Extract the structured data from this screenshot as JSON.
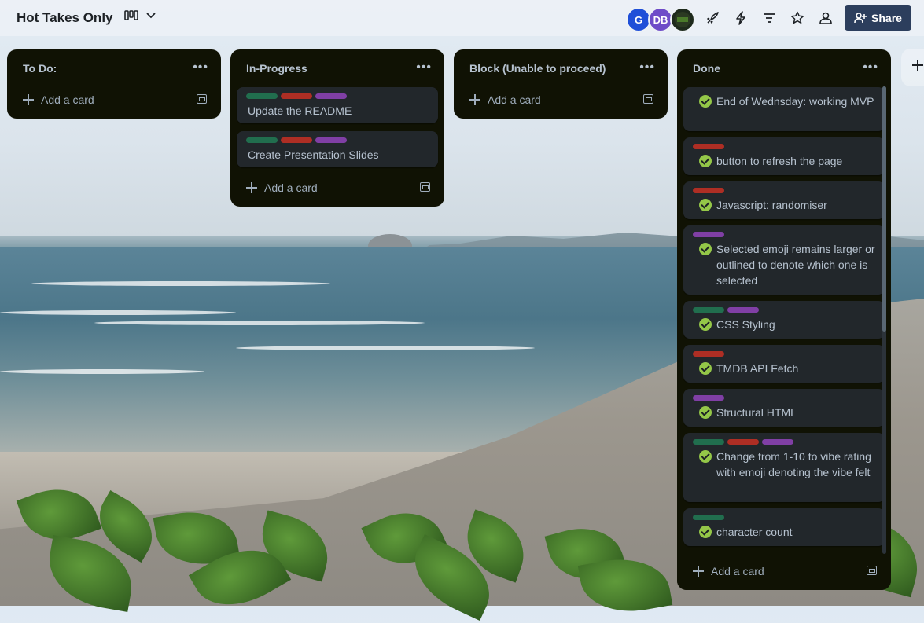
{
  "board": {
    "title": "Hot Takes Only"
  },
  "header": {
    "avatars": [
      {
        "initials": "G",
        "color": "#1f4fd8"
      },
      {
        "initials": "DB",
        "color": "#6e4cc8"
      },
      {
        "initials": "",
        "color": "#1e2a1c"
      }
    ],
    "share_label": "Share",
    "icons": [
      "view-board-icon",
      "chevron-down-icon",
      "rocket-icon",
      "lightning-icon",
      "filter-icon",
      "star-icon",
      "team-icon",
      "add-person-icon",
      "plus-icon"
    ]
  },
  "label_colors": {
    "green": "#216e4e",
    "red": "#ae2e24",
    "purple": "#803fa5"
  },
  "lists": {
    "todo": {
      "title": "To Do:",
      "add_card": "Add a card"
    },
    "inprogress": {
      "title": "In-Progress",
      "add_card": "Add a card",
      "cards": [
        {
          "title": "Update the README",
          "labels": [
            "green",
            "red",
            "purple"
          ]
        },
        {
          "title": "Create Presentation Slides",
          "labels": [
            "green",
            "red",
            "purple"
          ]
        }
      ]
    },
    "blocked": {
      "title": "Block (Unable to proceed)",
      "add_card": "Add a card"
    },
    "done": {
      "title": "Done",
      "add_card": "Add a card",
      "cards": [
        {
          "title": "End of Wednsday: working MVP",
          "labels": []
        },
        {
          "title": "button to refresh the page",
          "labels": [
            "red"
          ]
        },
        {
          "title": "Javascript: randomiser",
          "labels": [
            "red"
          ]
        },
        {
          "title": "Selected emoji remains larger or outlined to denote which one is selected",
          "labels": [
            "purple"
          ]
        },
        {
          "title": "CSS Styling",
          "labels": [
            "green",
            "purple"
          ]
        },
        {
          "title": "TMDB API Fetch",
          "labels": [
            "red"
          ]
        },
        {
          "title": "Structural HTML",
          "labels": [
            "purple"
          ]
        },
        {
          "title": "Change from 1-10 to vibe rating with emoji denoting the vibe felt",
          "labels": [
            "green",
            "red",
            "purple"
          ]
        },
        {
          "title": "character count",
          "labels": [
            "green"
          ]
        }
      ]
    }
  }
}
